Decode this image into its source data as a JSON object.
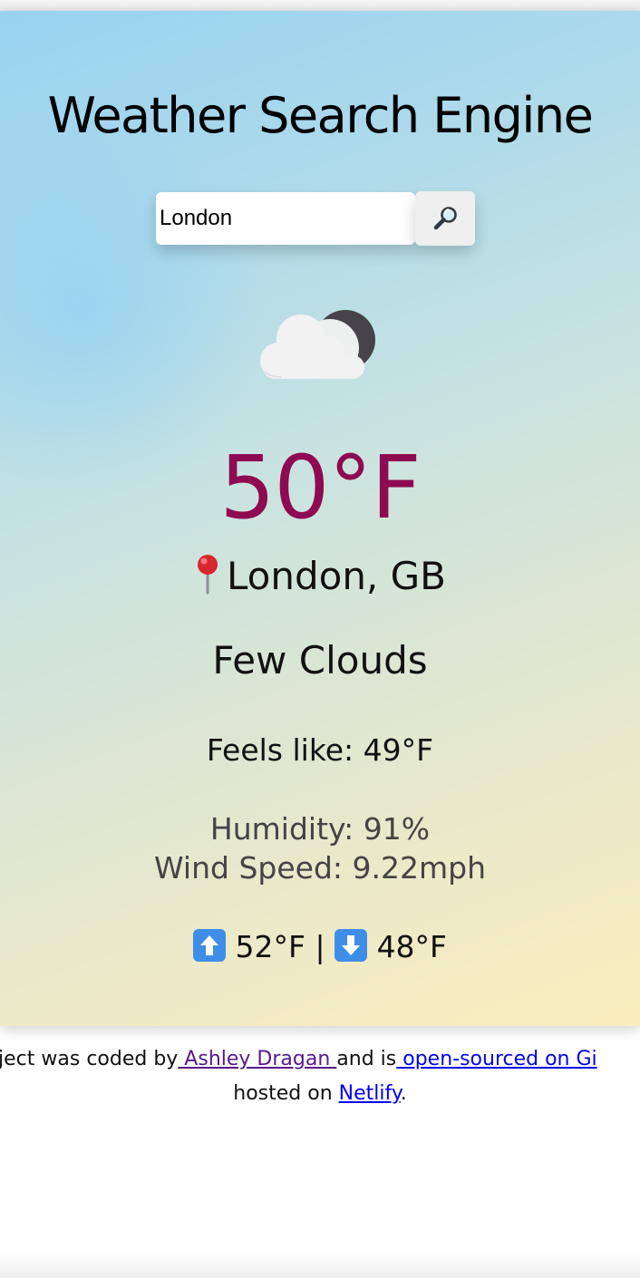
{
  "app": {
    "title": "Weather Search Engine"
  },
  "search": {
    "value": "London",
    "button_icon": "magnifying-glass-icon"
  },
  "current": {
    "icon": "few-clouds-night-icon",
    "temperature": "50°F",
    "location_icon": "round-pushpin-icon",
    "location": "London, GB",
    "description": "Few Clouds",
    "feels_like": "Feels like: 49°F",
    "humidity": "Humidity: 91%",
    "wind": "Wind Speed: 9.22mph",
    "high_icon": "up-arrow-icon",
    "high": "52°F",
    "separator": "|",
    "low_icon": "down-arrow-icon",
    "low": "48°F"
  },
  "colors": {
    "temperature": "#8e0a52",
    "arrow_badge": "#3e8ee8"
  },
  "footer": {
    "text_before": "roject was coded by",
    "author_link": " Ashley Dragan ",
    "text_middle": "and is",
    "source_link": " open-sourced on Gi",
    "text_hosted": "hosted on ",
    "host_link": "Netlify",
    "text_end": "."
  }
}
